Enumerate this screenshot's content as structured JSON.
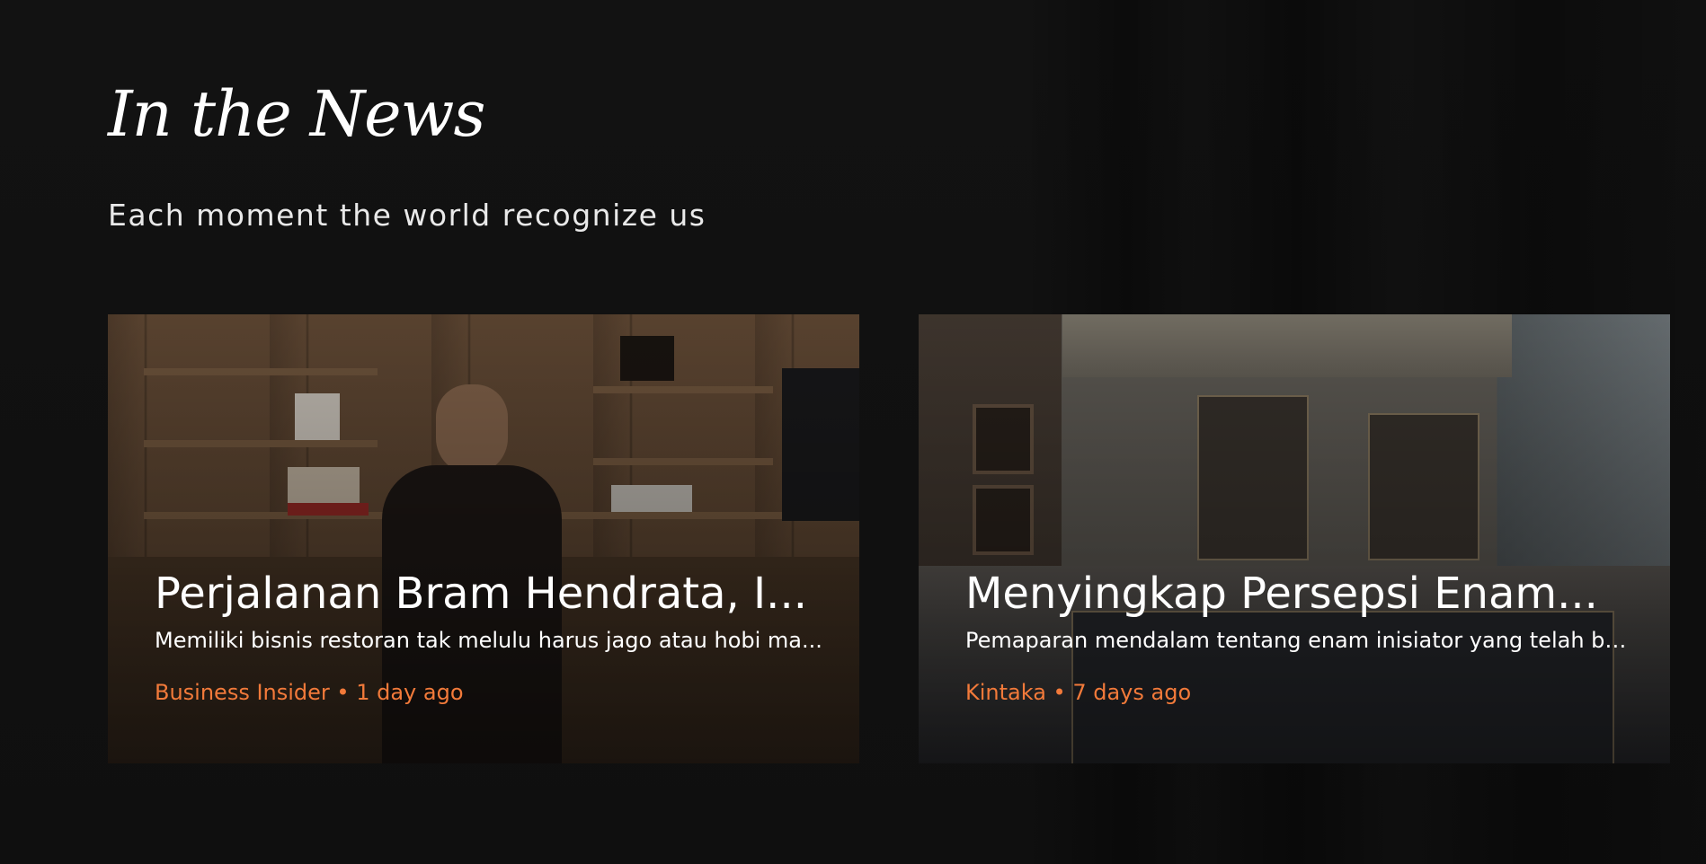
{
  "section": {
    "title": "In the News",
    "subtitle": "Each moment the world recognize us"
  },
  "colors": {
    "background": "#111111",
    "text": "#ffffff",
    "accent": "#f27a3a"
  },
  "articles": [
    {
      "title": "Perjalanan Bram Hendrata, I...",
      "excerpt": "Memiliki bisnis restoran tak melulu harus jago atau hobi ma...",
      "source": "Business Insider",
      "separator": "•",
      "age": "1 day ago",
      "meta": "Business Insider • 1 day ago",
      "image": "man-in-office-photo"
    },
    {
      "title": "Menyingkap Persepsi Enam...",
      "excerpt": "Pemaparan mendalam tentang enam inisiator yang telah be...",
      "source": "Kintaka",
      "separator": "•",
      "age": "7 days ago",
      "meta": "Kintaka • 7 days ago",
      "image": "mall-interior-photo"
    }
  ]
}
